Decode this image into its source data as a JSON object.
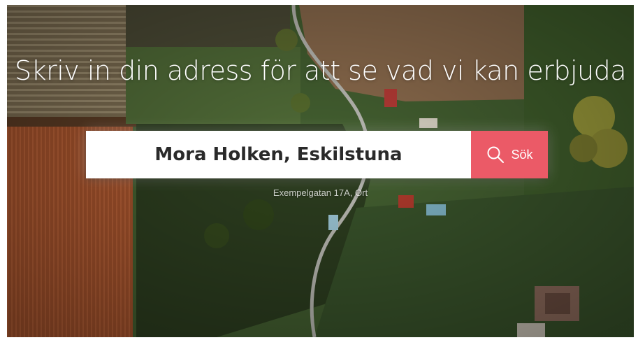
{
  "hero": {
    "headline": "Skriv in din adress för att se vad vi kan erbjuda"
  },
  "search": {
    "value": "Mora Holken, Eskilstuna",
    "button_label": "Sök",
    "hint": "Exempelgatan 17A, Ort"
  },
  "colors": {
    "button_background": "#eb5a67",
    "input_background": "#ffffff",
    "headline_text": "#ffffff"
  },
  "icons": {
    "search_button_icon": "search-icon"
  }
}
